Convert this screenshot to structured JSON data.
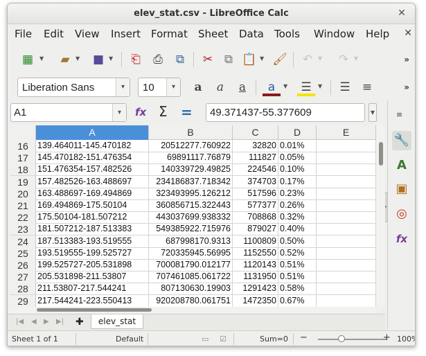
{
  "window": {
    "title": "elev_stat.csv - LibreOffice Calc"
  },
  "menu": [
    "File",
    "Edit",
    "View",
    "Insert",
    "Format",
    "Sheet",
    "Data",
    "Tools",
    "Window",
    "Help"
  ],
  "font": {
    "name": "Liberation Sans",
    "size": "10"
  },
  "formula_bar": {
    "cell_ref": "A1",
    "content": "49.371437-55.377609"
  },
  "columns": [
    "A",
    "B",
    "C",
    "D",
    "E"
  ],
  "rows": [
    {
      "num": "16",
      "a": "139.464011-145.470182",
      "b": "20512277.760922",
      "c": "32820",
      "d": "0.01%"
    },
    {
      "num": "17",
      "a": "145.470182-151.476354",
      "b": "69891117.76879",
      "c": "111827",
      "d": "0.05%"
    },
    {
      "num": "18",
      "a": "151.476354-157.482526",
      "b": "140339729.49825",
      "c": "224546",
      "d": "0.10%"
    },
    {
      "num": "19",
      "a": "157.482526-163.488697",
      "b": "234186837.718342",
      "c": "374703",
      "d": "0.17%"
    },
    {
      "num": "20",
      "a": "163.488697-169.494869",
      "b": "323493995.126212",
      "c": "517596",
      "d": "0.23%"
    },
    {
      "num": "21",
      "a": "169.494869-175.50104",
      "b": "360856715.322443",
      "c": "577377",
      "d": "0.26%"
    },
    {
      "num": "22",
      "a": "175.50104-181.507212",
      "b": "443037699.938332",
      "c": "708868",
      "d": "0.32%"
    },
    {
      "num": "23",
      "a": "181.507212-187.513383",
      "b": "549385922.715976",
      "c": "879027",
      "d": "0.40%"
    },
    {
      "num": "24",
      "a": "187.513383-193.519555",
      "b": "687998170.9313",
      "c": "1100809",
      "d": "0.50%"
    },
    {
      "num": "25",
      "a": "193.519555-199.525727",
      "b": "720335945.56995",
      "c": "1152550",
      "d": "0.52%"
    },
    {
      "num": "26",
      "a": "199.525727-205.531898",
      "b": "700081790.012177",
      "c": "1120143",
      "d": "0.51%"
    },
    {
      "num": "27",
      "a": "205.531898-211.53807",
      "b": "707461085.061722",
      "c": "1131950",
      "d": "0.51%"
    },
    {
      "num": "28",
      "a": "211.53807-217.544241",
      "b": "807130630.19903",
      "c": "1291423",
      "d": "0.58%"
    },
    {
      "num": "29",
      "a": "217.544241-223.550413",
      "b": "920208780.061751",
      "c": "1472350",
      "d": "0.67%"
    }
  ],
  "sheet_tabs": [
    "elev_stat"
  ],
  "status": {
    "sheet": "Sheet 1 of 1",
    "style": "Default",
    "sum": "Sum=0",
    "zoom": "100%"
  },
  "accent_color": "#4a90d9"
}
